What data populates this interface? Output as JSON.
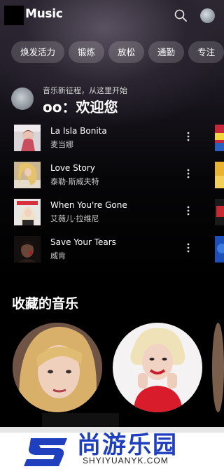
{
  "app": {
    "logo_text": "Music"
  },
  "chips": [
    "焕发活力",
    "锻炼",
    "放松",
    "通勤",
    "专注"
  ],
  "greeting": {
    "subtitle": "音乐新征程，从这里开始",
    "title": "oo：欢迎您"
  },
  "songs": [
    {
      "title": "La Isla Bonita",
      "artist": "麦当娜"
    },
    {
      "title": "Love Story",
      "artist": "泰勒·斯威夫特"
    },
    {
      "title": "When You're Gone",
      "artist": "艾薇儿·拉维尼"
    },
    {
      "title": "Save Your Tears",
      "artist": "威肯"
    }
  ],
  "favorites": {
    "title": "收藏的音乐"
  },
  "watermark": {
    "brand": "尚游乐园",
    "url": "SHYIYUANYK.COM"
  },
  "colors": {
    "background": "#000000",
    "chip_bg": "#3a3840",
    "watermark_blue": "#1f3fbf"
  },
  "icons": [
    "search-icon",
    "more-vert-icon",
    "avatar"
  ]
}
